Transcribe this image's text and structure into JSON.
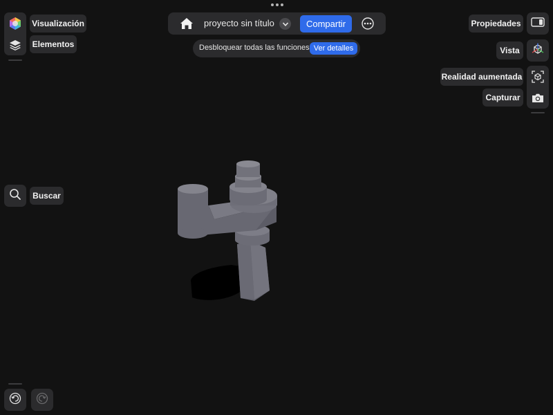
{
  "left_toolbar": {
    "visualization_label": "Visualización",
    "elements_label": "Elementos",
    "search_label": "Buscar"
  },
  "top_bar": {
    "project_title": "proyecto sin título",
    "share_label": "Compartir"
  },
  "banner": {
    "text": "Desbloquear todas las funciones",
    "details_label": "Ver detalles"
  },
  "right_toolbar": {
    "properties_label": "Propiedades",
    "view_label": "Vista",
    "ar_label": "Realidad aumentada",
    "capture_label": "Capturar"
  },
  "colors": {
    "background": "#121212",
    "panel": "#2b2b2d",
    "accent": "#2f6bea",
    "model": "#6e6e78"
  },
  "icons": [
    "color-wheel-icon",
    "layers-icon",
    "search-icon",
    "undo-icon",
    "redo-icon",
    "home-icon",
    "chevron-down-icon",
    "more-icon",
    "sidebar-panel-icon",
    "view-cube-icon",
    "ar-icon",
    "camera-icon"
  ]
}
